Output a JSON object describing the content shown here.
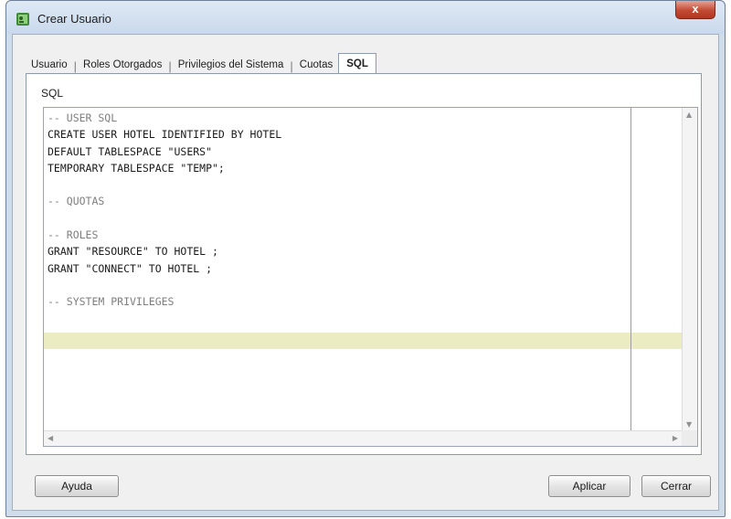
{
  "window": {
    "title": "Crear Usuario",
    "close_label": "x"
  },
  "tabs": [
    {
      "label": "Usuario",
      "active": false
    },
    {
      "label": "Roles Otorgados",
      "active": false
    },
    {
      "label": "Privilegios del Sistema",
      "active": false
    },
    {
      "label": "Cuotas",
      "active": false
    },
    {
      "label": "SQL",
      "active": true
    }
  ],
  "panel": {
    "section_label": "SQL"
  },
  "code": {
    "lines": [
      "-- USER SQL",
      "CREATE USER HOTEL IDENTIFIED BY HOTEL",
      "DEFAULT TABLESPACE \"USERS\"",
      "TEMPORARY TABLESPACE \"TEMP\";",
      "",
      "-- QUOTAS",
      "",
      "-- ROLES",
      "GRANT \"RESOURCE\" TO HOTEL ;",
      "GRANT \"CONNECT\" TO HOTEL ;",
      "",
      "-- SYSTEM PRIVILEGES",
      ""
    ]
  },
  "buttons": {
    "help": "Ayuda",
    "apply": "Aplicar",
    "close": "Cerrar"
  },
  "colors": {
    "current_line_highlight": "#ececc3",
    "comment_text": "#7f7f7f"
  }
}
